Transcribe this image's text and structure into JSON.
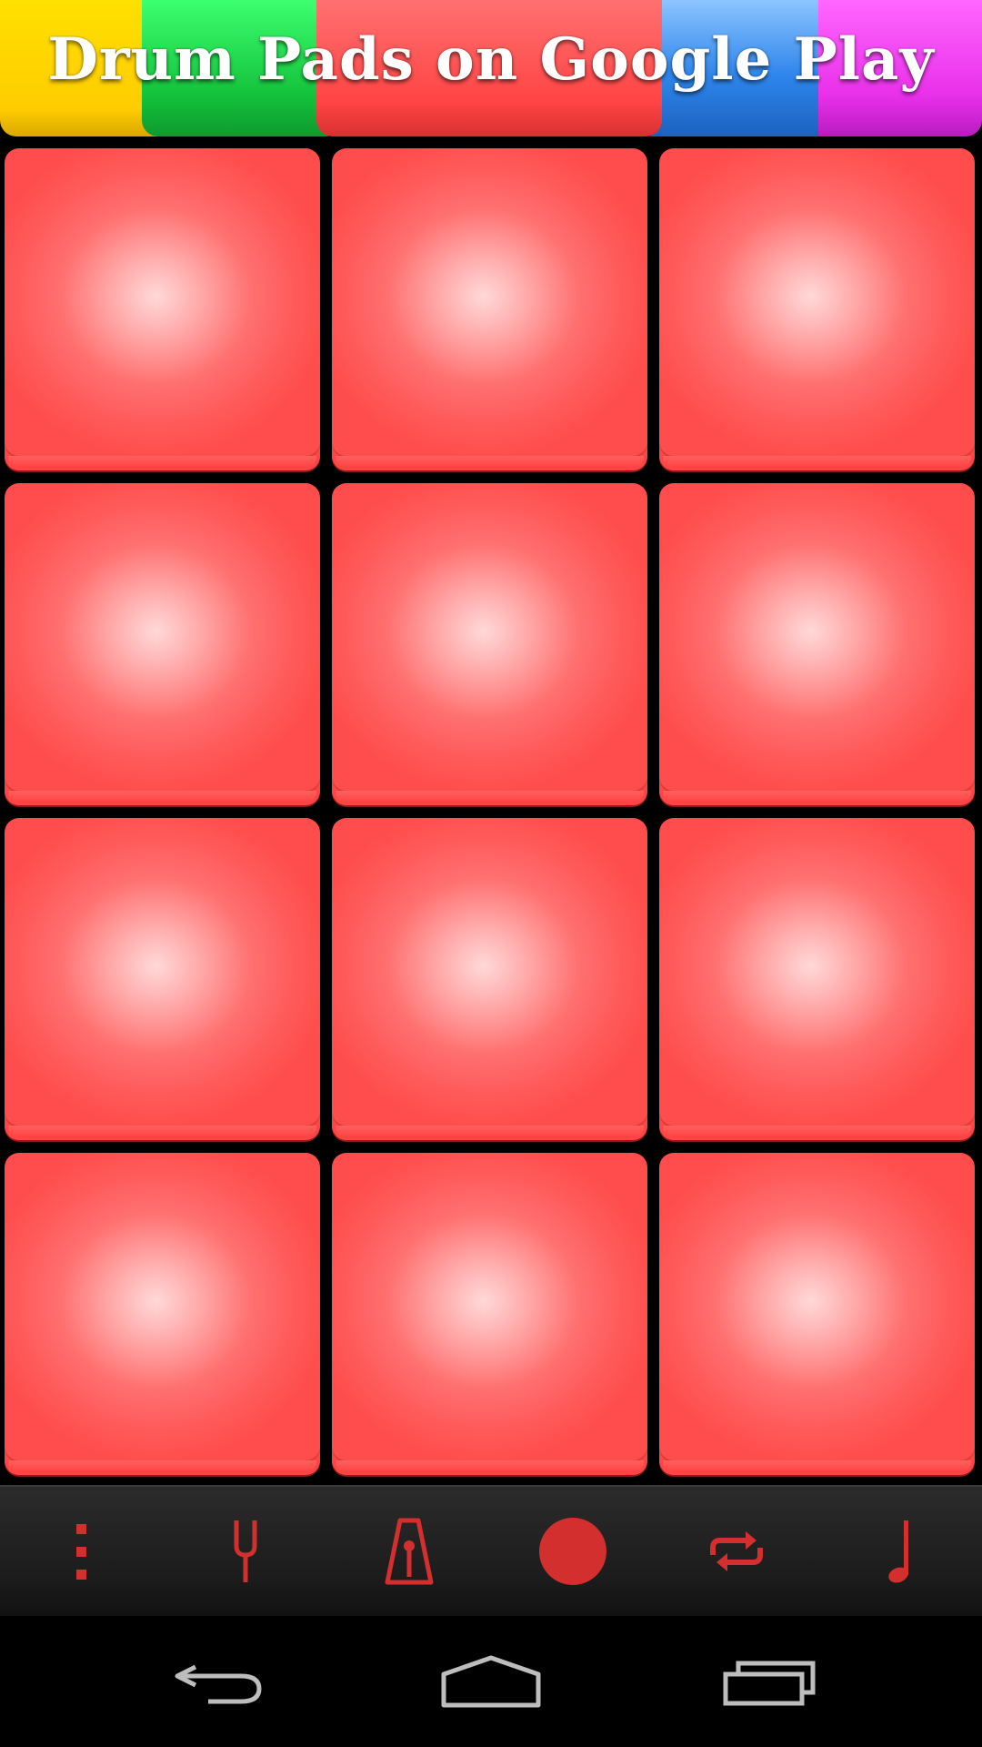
{
  "banner": {
    "title": "Drum Pads on Google Play",
    "colors": [
      "#ffd400",
      "#1fc94a",
      "#ff4a4a",
      "#3a8cf0",
      "#ee3df0"
    ]
  },
  "pads": {
    "count": 12,
    "columns": 3,
    "rows": 4,
    "color": "#ff5252"
  },
  "toolbar": {
    "accent": "#d32f2f",
    "items": [
      {
        "name": "menu",
        "icon": "vertical-dots-icon"
      },
      {
        "name": "tuning",
        "icon": "tuning-fork-icon"
      },
      {
        "name": "metronome",
        "icon": "metronome-icon"
      },
      {
        "name": "record",
        "icon": "record-icon"
      },
      {
        "name": "loop",
        "icon": "loop-icon"
      },
      {
        "name": "sounds",
        "icon": "music-note-icon"
      }
    ]
  },
  "navbar": {
    "items": [
      {
        "name": "back",
        "icon": "back-icon"
      },
      {
        "name": "home",
        "icon": "home-icon"
      },
      {
        "name": "recents",
        "icon": "recents-icon"
      }
    ]
  }
}
